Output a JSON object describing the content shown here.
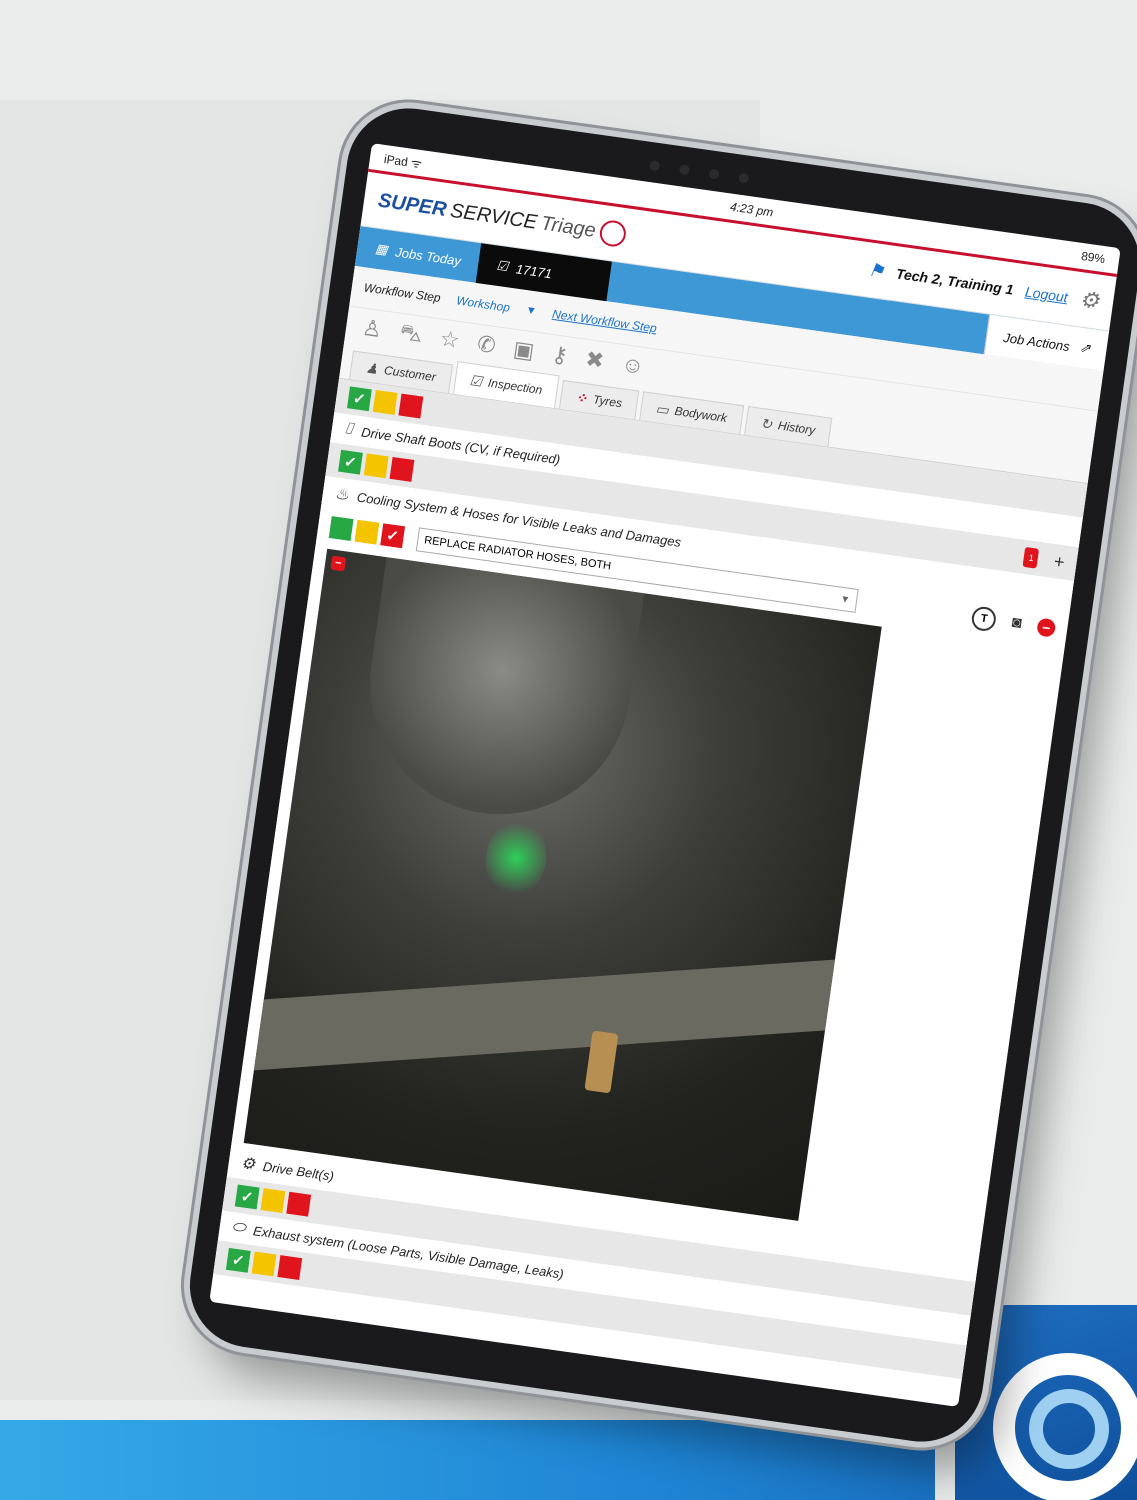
{
  "status_bar": {
    "device": "iPad ᯤ",
    "time": "4:23 pm",
    "battery": "89%"
  },
  "header": {
    "brand_super": "SUPER",
    "brand_service": "SERVICE",
    "brand_triage": "Triage",
    "user_name": "Tech 2,  Training 1",
    "logout": "Logout"
  },
  "tabs": {
    "jobs_today": "Jobs Today",
    "job_number": "17171",
    "job_actions": "Job Actions"
  },
  "workflow": {
    "label": "Workflow Step",
    "value": "Workshop",
    "next": "Next Workflow Step"
  },
  "main_tabs": {
    "customer": "Customer",
    "inspection": "Inspection",
    "tyres": "Tyres",
    "bodywork": "Bodywork",
    "history": "History"
  },
  "items": {
    "drive_shaft": "Drive Shaft Boots (CV, if Required)",
    "cooling": "Cooling System & Hoses for Visible Leaks and Damages",
    "cooling_note": "REPLACE RADIATOR HOSES, BOTH",
    "cooling_badge": "1",
    "drive_belt": "Drive Belt(s)",
    "exhaust": "Exhaust system (Loose Parts, Visible Damage, Leaks)"
  },
  "colors": {
    "brand_blue": "#3f98d6",
    "accent_red": "#c8102e",
    "ok_green": "#27a845",
    "warn_yellow": "#f5c400",
    "bad_red": "#e0141d"
  }
}
